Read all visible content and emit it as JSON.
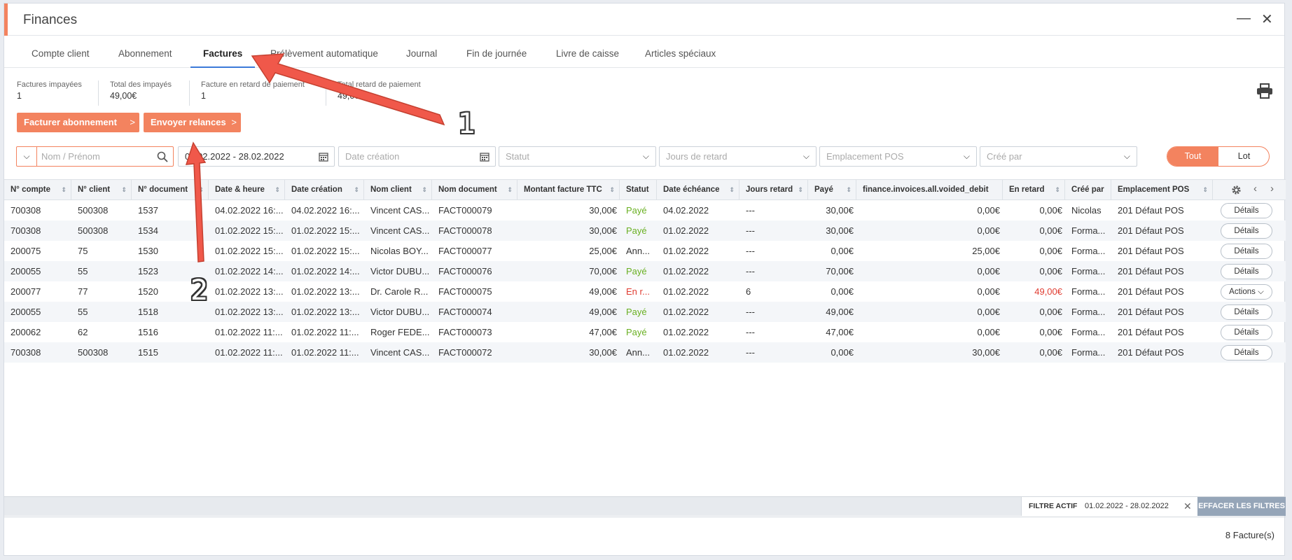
{
  "window": {
    "title": "Finances"
  },
  "tabs": [
    {
      "label": "Compte client",
      "active": false
    },
    {
      "label": "Abonnement",
      "active": false
    },
    {
      "label": "Factures",
      "active": true
    },
    {
      "label": "Prélèvement automatique",
      "active": false
    },
    {
      "label": "Journal",
      "active": false
    },
    {
      "label": "Fin de journée",
      "active": false
    },
    {
      "label": "Livre de caisse",
      "active": false
    },
    {
      "label": "Articles spéciaux",
      "active": false
    }
  ],
  "stats": [
    {
      "label": "Factures impayées",
      "value": "1"
    },
    {
      "label": "Total des impayés",
      "value": "49,00€"
    },
    {
      "label": "Facture en retard de paiement",
      "value": "1"
    },
    {
      "label": "Total retard de paiement",
      "value": "49,00€"
    }
  ],
  "actions": {
    "bill_label": "Facturer abonnement",
    "reminders_label": "Envoyer relances",
    "chevron": ">"
  },
  "filters": {
    "search_placeholder": "Nom / Prénom",
    "date_range": "01.02.2022 - 28.02.2022",
    "date_creation_placeholder": "Date création",
    "statut_placeholder": "Statut",
    "jours_placeholder": "Jours de retard",
    "emplacement_placeholder": "Emplacement POS",
    "cree_par_placeholder": "Créé par"
  },
  "toggle": {
    "on": "Tout",
    "off": "Lot"
  },
  "table": {
    "columns": [
      "N° compte",
      "N° client",
      "N° document",
      "Date & heure",
      "Date création",
      "Nom client",
      "Nom document",
      "Montant facture TTC",
      "Statut",
      "Date échéance",
      "Jours retard",
      "Payé",
      "finance.invoices.all.voided_debit",
      "En retard",
      "Créé par",
      "Emplacement POS"
    ],
    "rows": [
      [
        "700308",
        "500308",
        "1537",
        "04.02.2022 16:...",
        "04.02.2022 16:...",
        "Vincent CAS...",
        "FACT000079",
        "30,00€",
        "Payé",
        "04.02.2022",
        "---",
        "30,00€",
        "0,00€",
        "0,00€",
        "Nicolas",
        "201 Défaut POS",
        "Détails"
      ],
      [
        "700308",
        "500308",
        "1534",
        "01.02.2022 15:...",
        "01.02.2022 15:...",
        "Vincent CAS...",
        "FACT000078",
        "30,00€",
        "Payé",
        "01.02.2022",
        "---",
        "30,00€",
        "0,00€",
        "0,00€",
        "Forma...",
        "201 Défaut POS",
        "Détails"
      ],
      [
        "200075",
        "75",
        "1530",
        "01.02.2022 15:...",
        "01.02.2022 15:...",
        "Nicolas BOY...",
        "FACT000077",
        "25,00€",
        "Ann...",
        "01.02.2022",
        "---",
        "0,00€",
        "25,00€",
        "0,00€",
        "Forma...",
        "201 Défaut POS",
        "Détails"
      ],
      [
        "200055",
        "55",
        "1523",
        "01.02.2022 14:...",
        "01.02.2022 14:...",
        "Victor DUBU...",
        "FACT000076",
        "70,00€",
        "Payé",
        "01.02.2022",
        "---",
        "70,00€",
        "0,00€",
        "0,00€",
        "Forma...",
        "201 Défaut POS",
        "Détails"
      ],
      [
        "200077",
        "77",
        "1520",
        "01.02.2022 13:...",
        "01.02.2022 13:...",
        "Dr. Carole R...",
        "FACT000075",
        "49,00€",
        "En r...",
        "01.02.2022",
        "6",
        "0,00€",
        "0,00€",
        "49,00€",
        "Forma...",
        "201 Défaut POS",
        "Actions"
      ],
      [
        "200055",
        "55",
        "1518",
        "01.02.2022 13:...",
        "01.02.2022 13:...",
        "Victor DUBU...",
        "FACT000074",
        "49,00€",
        "Payé",
        "01.02.2022",
        "---",
        "49,00€",
        "0,00€",
        "0,00€",
        "Forma...",
        "201 Défaut POS",
        "Détails"
      ],
      [
        "200062",
        "62",
        "1516",
        "01.02.2022 11:...",
        "01.02.2022 11:...",
        "Roger FEDE...",
        "FACT000073",
        "47,00€",
        "Payé",
        "01.02.2022",
        "---",
        "47,00€",
        "0,00€",
        "0,00€",
        "Forma...",
        "201 Défaut POS",
        "Détails"
      ],
      [
        "700308",
        "500308",
        "1515",
        "01.02.2022 11:...",
        "01.02.2022 11:...",
        "Vincent CAS...",
        "FACT000072",
        "30,00€",
        "Ann...",
        "01.02.2022",
        "---",
        "0,00€",
        "30,00€",
        "0,00€",
        "Forma...",
        "201 Défaut POS",
        "Détails"
      ]
    ]
  },
  "footer": {
    "active_filter_label": "FILTRE ACTIF",
    "active_filter_value": "01.02.2022 - 28.02.2022",
    "clear_label": "EFFACER LES FILTRES",
    "count": "8 Facture(s)"
  },
  "annotations": [
    "1",
    "2"
  ],
  "colors": {
    "accent": "#f3835f",
    "paid": "#6ab023",
    "late": "#e03c31",
    "tab_underline": "#3b7ad9",
    "arrow": "#f0584a"
  },
  "icons": [
    "minimize-icon",
    "close-icon",
    "print-icon",
    "search-icon",
    "calendar-icon",
    "chevron-down-icon",
    "gear-icon",
    "chevron-left-icon",
    "chevron-right-icon",
    "sort-icon"
  ]
}
